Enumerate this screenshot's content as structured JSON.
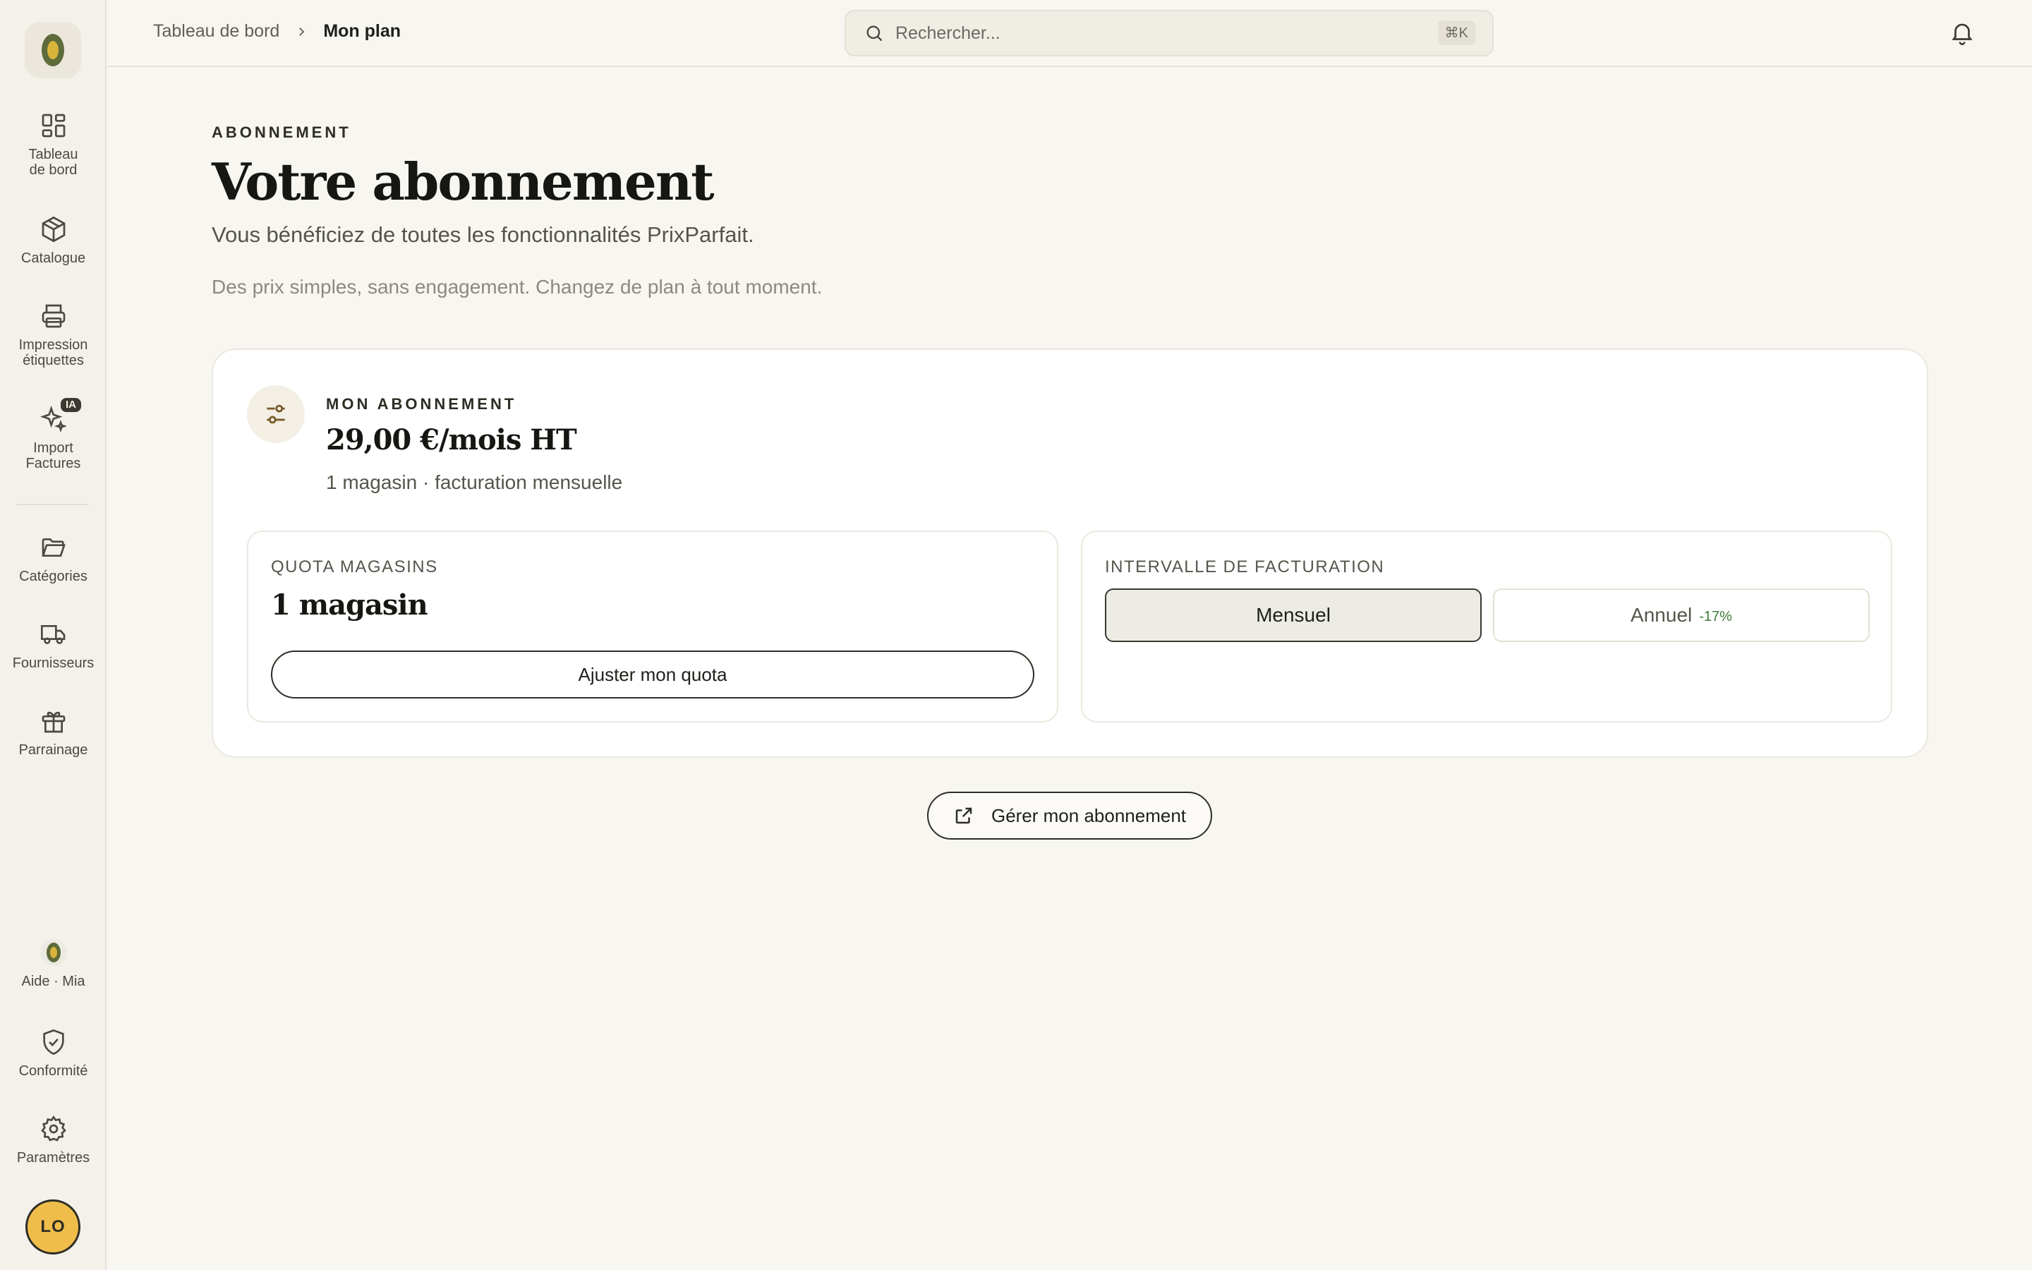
{
  "sidebar": {
    "items": [
      {
        "label": "Tableau\nde bord",
        "icon": "grid-icon"
      },
      {
        "label": "Catalogue",
        "icon": "box-icon"
      },
      {
        "label": "Impression\nétiquettes",
        "icon": "printer-icon"
      },
      {
        "label": "Import\nFactures",
        "icon": "sparkles-icon",
        "badge": "IA"
      },
      {
        "label": "Catégories",
        "icon": "folder-icon"
      },
      {
        "label": "Fournisseurs",
        "icon": "truck-icon"
      },
      {
        "label": "Parrainage",
        "icon": "gift-icon"
      }
    ],
    "bottom": [
      {
        "label": "Aide · Mia",
        "icon": "mia-icon"
      },
      {
        "label": "Conformité",
        "icon": "shield-check-icon"
      },
      {
        "label": "Paramètres",
        "icon": "gear-icon"
      }
    ],
    "avatar_initials": "LO"
  },
  "topbar": {
    "breadcrumb": {
      "parent": "Tableau de bord",
      "current": "Mon plan"
    },
    "search_placeholder": "Rechercher...",
    "search_shortcut": "⌘K"
  },
  "page": {
    "eyebrow": "ABONNEMENT",
    "title": "Votre abonnement",
    "subtitle": "Vous bénéficiez de toutes les fonctionnalités PrixParfait.",
    "tagline": "Des prix simples, sans engagement. Changez de plan à tout moment."
  },
  "subscription": {
    "eyebrow": "MON ABONNEMENT",
    "price": "29,00 €/mois HT",
    "detail": "1 magasin · facturation mensuelle",
    "quota": {
      "label": "QUOTA MAGASINS",
      "value": "1 magasin",
      "button": "Ajuster mon quota"
    },
    "billing": {
      "label": "INTERVALLE DE FACTURATION",
      "options": [
        {
          "label": "Mensuel",
          "selected": true
        },
        {
          "label": "Annuel",
          "discount": "-17%",
          "selected": false
        }
      ]
    },
    "manage_button": "Gérer mon abonnement"
  },
  "colors": {
    "background": "#f8f6f1",
    "sidebar": "#f3f1ea",
    "accent_dark": "#2d2d25",
    "avatar": "#efbd4a",
    "discount_green": "#3c7a36",
    "logo_green": "#5e6b3a",
    "logo_gold": "#d9b33a"
  }
}
